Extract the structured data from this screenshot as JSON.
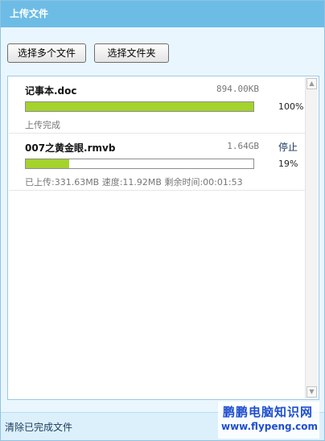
{
  "window": {
    "title": "上传文件"
  },
  "toolbar": {
    "select_files_label": "选择多个文件",
    "select_folder_label": "选择文件夹"
  },
  "uploads": [
    {
      "filename": "记事本.doc",
      "size": "894.00KB",
      "progress_percent": 100,
      "progress_text": "100%",
      "status": "上传完成",
      "action_label": ""
    },
    {
      "filename": "007之黄金眼.rmvb",
      "size": "1.64GB",
      "progress_percent": 19,
      "progress_text": "19%",
      "status": "已上传:331.63MB 速度:11.92MB 剩余时间:00:01:53",
      "action_label": "停止"
    }
  ],
  "footer": {
    "clear_completed_label": "清除已完成文件"
  },
  "watermark": {
    "line1": "鹏鹏电脑知识网",
    "line2": "www.flypeng.com"
  },
  "colors": {
    "title_bar": "#6dbce6",
    "progress_fill": "#a3d32c",
    "background": "#eaf6fd"
  }
}
